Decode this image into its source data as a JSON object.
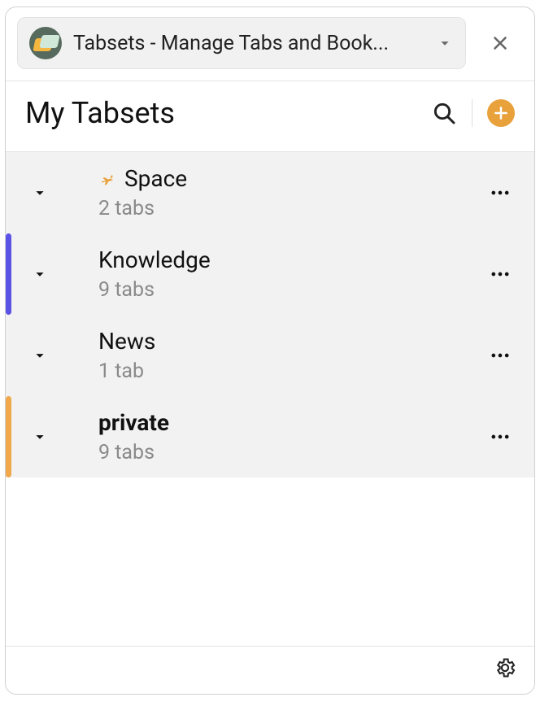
{
  "topbar": {
    "tab_title": "Tabsets - Manage Tabs and Book..."
  },
  "header": {
    "title": "My Tabsets"
  },
  "tabsets": [
    {
      "name": "Space",
      "count_label": "2 tabs",
      "pinned": true,
      "bold": false,
      "accent": null
    },
    {
      "name": "Knowledge",
      "count_label": "9 tabs",
      "pinned": false,
      "bold": false,
      "accent": "#5b52e6"
    },
    {
      "name": "News",
      "count_label": "1 tab",
      "pinned": false,
      "bold": false,
      "accent": null
    },
    {
      "name": "private",
      "count_label": "9 tabs",
      "pinned": false,
      "bold": true,
      "accent": "#f0a84b"
    }
  ]
}
